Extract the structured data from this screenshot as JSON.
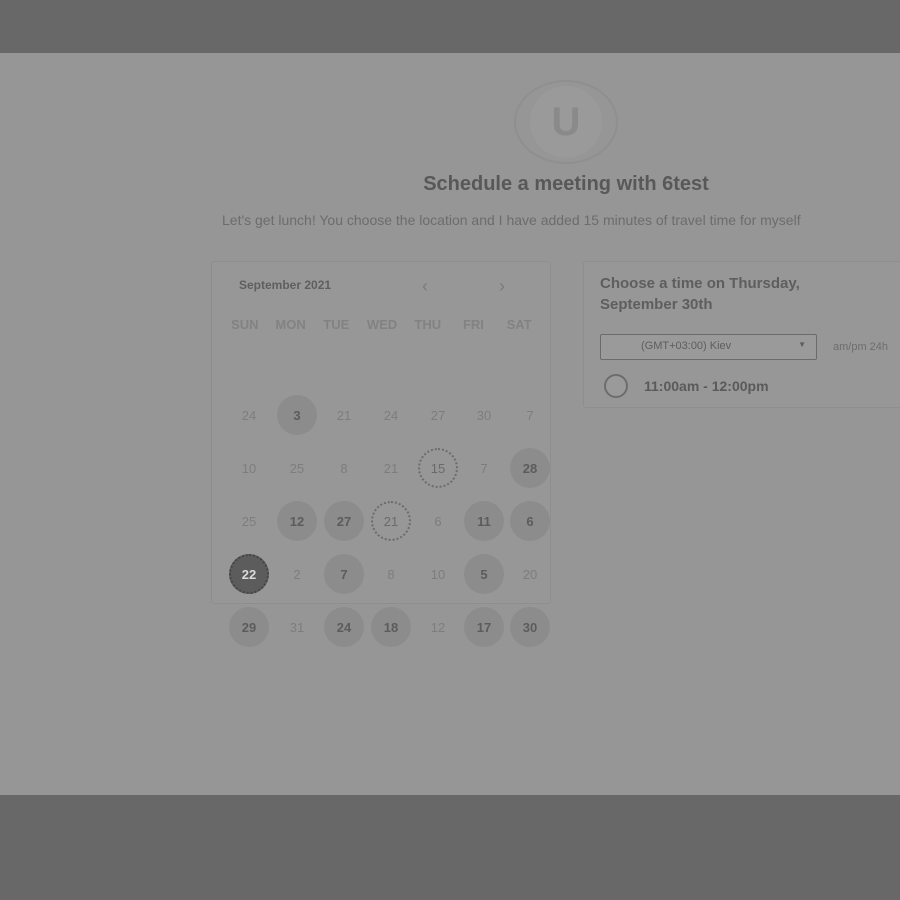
{
  "page": {
    "logo_letter": "U",
    "title": "Schedule a meeting with 6test",
    "description": "Let's get lunch! You choose the location and I have added 15 minutes of travel time for myself"
  },
  "calendar": {
    "month_label": "September 2021",
    "prev_icon": "‹",
    "next_icon": "›",
    "weekdays": [
      "SUN",
      "MON",
      "TUE",
      "WED",
      "THU",
      "FRI",
      "SAT"
    ],
    "weeks": [
      [
        {
          "d": "24",
          "s": "plain"
        },
        {
          "d": "3",
          "s": "available"
        },
        {
          "d": "21",
          "s": "plain"
        },
        {
          "d": "24",
          "s": "plain"
        },
        {
          "d": "27",
          "s": "plain"
        },
        {
          "d": "30",
          "s": "plain"
        },
        {
          "d": "7",
          "s": "plain"
        }
      ],
      [
        {
          "d": "10",
          "s": "plain"
        },
        {
          "d": "25",
          "s": "plain"
        },
        {
          "d": "8",
          "s": "plain"
        },
        {
          "d": "21",
          "s": "plain"
        },
        {
          "d": "15",
          "s": "dotted"
        },
        {
          "d": "7",
          "s": "plain"
        },
        {
          "d": "28",
          "s": "available"
        }
      ],
      [
        {
          "d": "25",
          "s": "plain"
        },
        {
          "d": "12",
          "s": "available"
        },
        {
          "d": "27",
          "s": "available"
        },
        {
          "d": "21",
          "s": "dotted"
        },
        {
          "d": "6",
          "s": "plain"
        },
        {
          "d": "11",
          "s": "available"
        },
        {
          "d": "6",
          "s": "available"
        }
      ],
      [
        {
          "d": "22",
          "s": "selected"
        },
        {
          "d": "2",
          "s": "plain"
        },
        {
          "d": "7",
          "s": "available"
        },
        {
          "d": "8",
          "s": "plain"
        },
        {
          "d": "10",
          "s": "plain"
        },
        {
          "d": "5",
          "s": "available"
        },
        {
          "d": "20",
          "s": "plain"
        }
      ],
      [
        {
          "d": "29",
          "s": "available"
        },
        {
          "d": "31",
          "s": "plain"
        },
        {
          "d": "24",
          "s": "available"
        },
        {
          "d": "18",
          "s": "available"
        },
        {
          "d": "12",
          "s": "plain"
        },
        {
          "d": "17",
          "s": "available"
        },
        {
          "d": "30",
          "s": "available"
        }
      ]
    ]
  },
  "times": {
    "heading": "Choose a time on Thursday, September 30th",
    "timezone": "(GMT+03:00) Kiev",
    "format_toggle": "am/pm  24h",
    "slots": [
      {
        "label": "11:00am - 12:00pm"
      }
    ]
  },
  "colors": {
    "backdrop": "#686868",
    "sheet": "#969696"
  }
}
